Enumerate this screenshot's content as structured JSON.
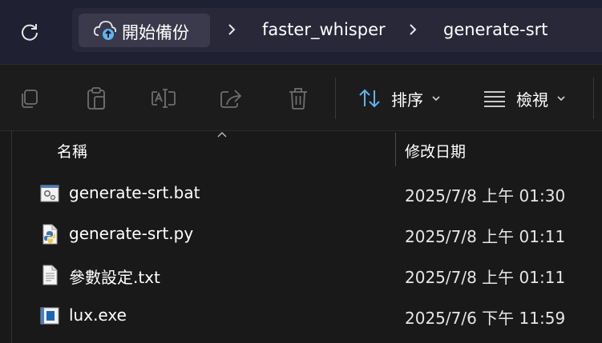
{
  "breadcrumb": {
    "home_label": "開始備份",
    "items": [
      "faster_whisper",
      "generate-srt"
    ]
  },
  "toolbar": {
    "icons": [
      "copy-icon",
      "paste-icon",
      "rename-icon",
      "share-icon",
      "delete-icon"
    ],
    "sort_label": "排序",
    "view_label": "檢視"
  },
  "columns": {
    "name": "名稱",
    "date_modified": "修改日期"
  },
  "files": [
    {
      "name": "generate-srt.bat",
      "date": "2025/7/8 上午 01:30",
      "icon": "batch-file-icon"
    },
    {
      "name": "generate-srt.py",
      "date": "2025/7/8 上午 01:11",
      "icon": "python-file-icon"
    },
    {
      "name": "參數設定.txt",
      "date": "2025/7/8 上午 01:11",
      "icon": "text-file-icon"
    },
    {
      "name": "lux.exe",
      "date": "2025/7/6 下午 11:59",
      "icon": "exe-file-icon"
    }
  ],
  "colors": {
    "address_bar_bg": "#202033",
    "crumb_bg": "#282839",
    "home_crumb_bg": "#3a3a4c",
    "accent_blue": "#60b4f0",
    "list_bg": "#191919"
  }
}
